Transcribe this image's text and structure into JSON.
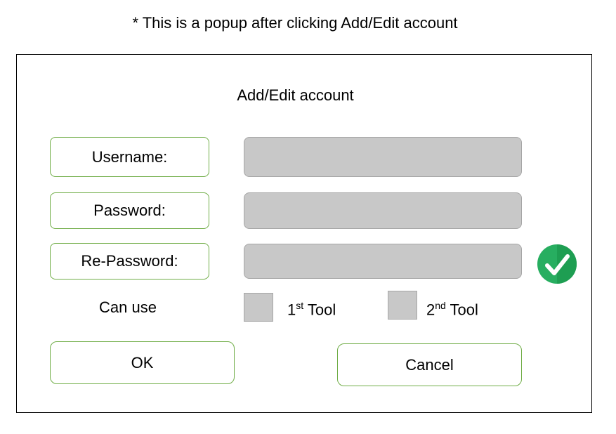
{
  "annotation": "* This is a popup after clicking Add/Edit account",
  "dialog": {
    "title": "Add/Edit account",
    "fields": {
      "username": {
        "label": "Username:",
        "value": ""
      },
      "password": {
        "label": "Password:",
        "value": ""
      },
      "repassword": {
        "label": "Re-Password:",
        "value": ""
      }
    },
    "match_icon": "check-circle-icon",
    "can_use_label": "Can use",
    "tools": [
      {
        "label_main": "1",
        "label_sup": "st",
        "label_rest": " Tool",
        "checked": false
      },
      {
        "label_main": "2",
        "label_sup": "nd",
        "label_rest": " Tool",
        "checked": false
      }
    ],
    "ok_label": "OK",
    "cancel_label": "Cancel"
  },
  "colors": {
    "accent_border": "#70ad47",
    "field_fill": "#c8c8c8",
    "check_green": "#27ae60"
  }
}
